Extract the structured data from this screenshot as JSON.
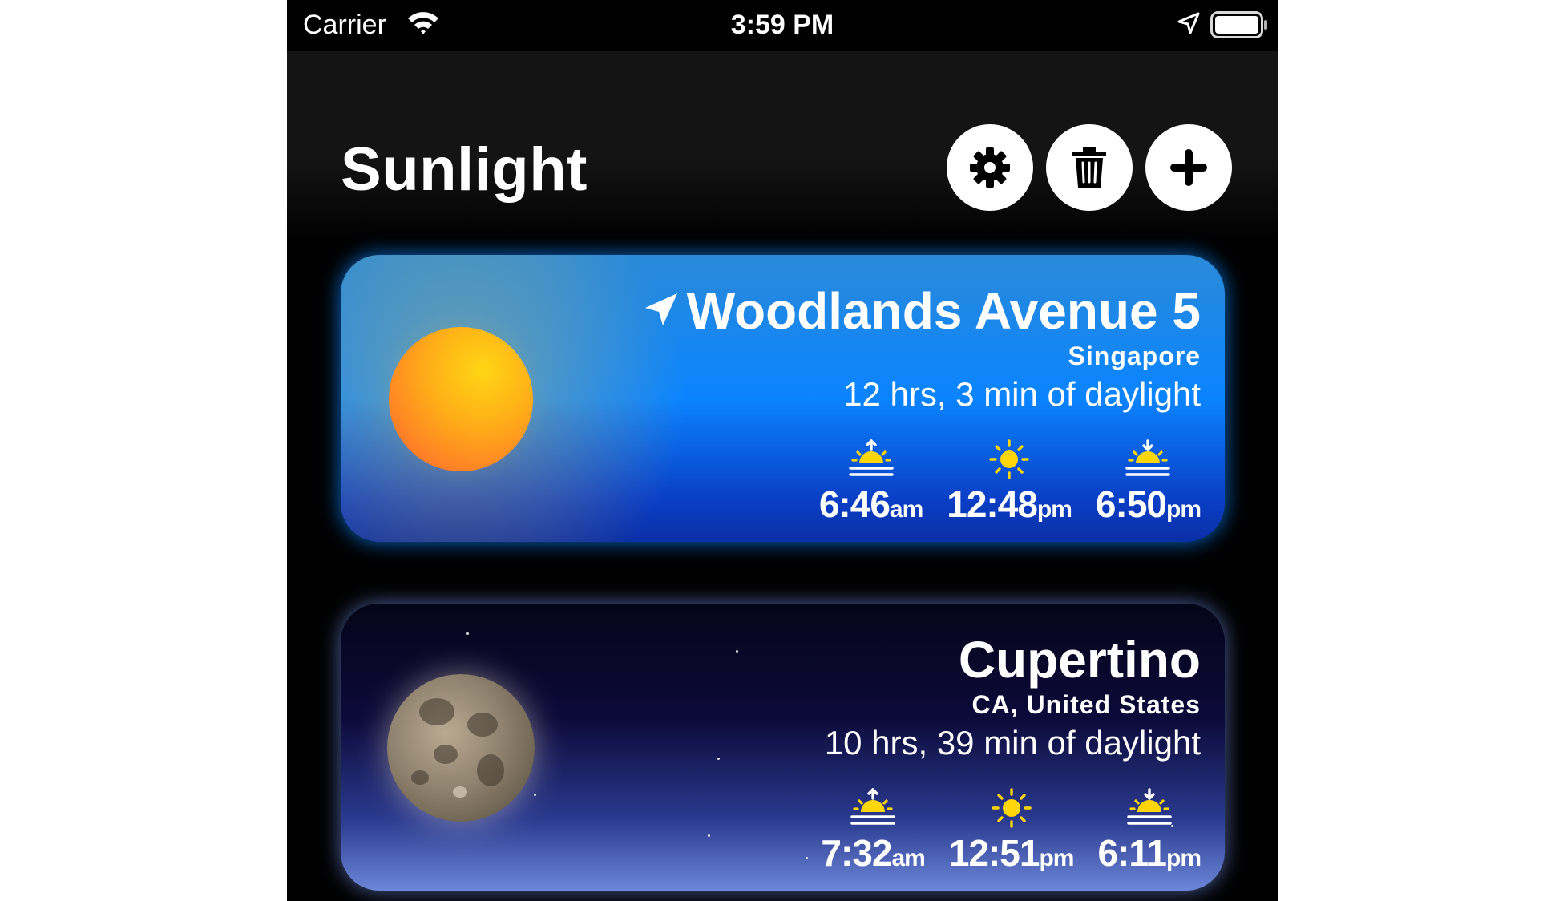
{
  "status_bar": {
    "carrier": "Carrier",
    "time": "3:59 PM",
    "icons": [
      "wifi-icon",
      "location-arrow-icon",
      "battery-icon"
    ]
  },
  "header": {
    "title": "Sunlight",
    "buttons": [
      {
        "icon": "gear-icon",
        "action": "settings"
      },
      {
        "icon": "trash-icon",
        "action": "delete"
      },
      {
        "icon": "plus-icon",
        "action": "add"
      }
    ]
  },
  "locations": [
    {
      "name": "Woodlands Avenue 5",
      "is_current_location": true,
      "region": "Singapore",
      "daylight": "12 hrs, 3 min of daylight",
      "sky": "day",
      "sunrise": {
        "time": "6:46",
        "suffix": "am"
      },
      "noon": {
        "time": "12:48",
        "suffix": "pm"
      },
      "sunset": {
        "time": "6:50",
        "suffix": "pm"
      }
    },
    {
      "name": "Cupertino",
      "is_current_location": false,
      "region": "CA, United States",
      "daylight": "10 hrs, 39 min of daylight",
      "sky": "night",
      "sunrise": {
        "time": "7:32",
        "suffix": "am"
      },
      "noon": {
        "time": "12:51",
        "suffix": "pm"
      },
      "sunset": {
        "time": "6:11",
        "suffix": "pm"
      }
    }
  ],
  "colors": {
    "icon_yellow": "#ffd60a",
    "day_blue": "#0a84ff",
    "night_navy": "#0c0a3a"
  }
}
